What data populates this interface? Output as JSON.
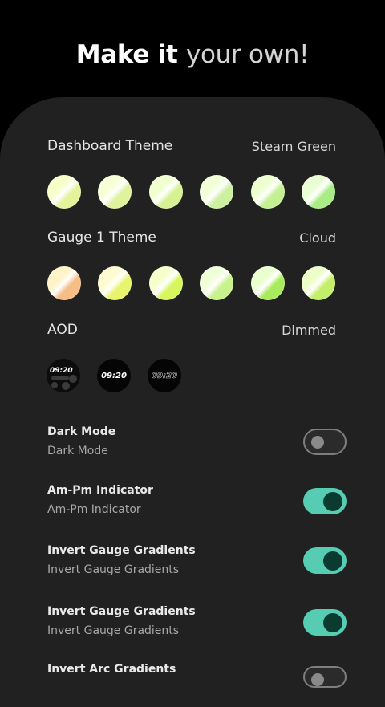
{
  "headline": {
    "main": "Make it",
    "accent": "your own!"
  },
  "dashboard_theme": {
    "title": "Dashboard Theme",
    "value": "Steam Green",
    "swatches": [
      {
        "color_a": "#f7ffc9",
        "color_b": "#e4f39a"
      },
      {
        "color_a": "#f7ffd6",
        "color_b": "#dff29d"
      },
      {
        "color_a": "#f1ffd0",
        "color_b": "#d5f191"
      },
      {
        "color_a": "#f2ffd7",
        "color_b": "#cdf0a0"
      },
      {
        "color_a": "#eeffd0",
        "color_b": "#c4f093"
      },
      {
        "color_a": "#eaffd6",
        "color_b": "#a9ec86"
      }
    ]
  },
  "gauge1_theme": {
    "title": "Gauge 1 Theme",
    "value": "Cloud",
    "swatches": [
      {
        "color_a": "#fff3c8",
        "color_b": "#f6be86"
      },
      {
        "color_a": "#fffbd0",
        "color_b": "#e8f46e"
      },
      {
        "color_a": "#f6ffcc",
        "color_b": "#d7f55c"
      },
      {
        "color_a": "#f0ffd7",
        "color_b": "#c9f28d"
      },
      {
        "color_a": "#eaffd0",
        "color_b": "#aaeb5e"
      },
      {
        "color_a": "#efffc9",
        "color_b": "#c3ee6a"
      }
    ]
  },
  "aod": {
    "title": "AOD",
    "value": "Dimmed",
    "options": [
      {
        "time": "09:20"
      },
      {
        "time": "09:20"
      },
      {
        "time": "09:20"
      }
    ]
  },
  "toggles": [
    {
      "title": "Dark Mode",
      "subtitle": "Dark Mode",
      "state": "off"
    },
    {
      "title": "Am-Pm Indicator",
      "subtitle": "Am-Pm Indicator",
      "state": "on"
    },
    {
      "title": "Invert Gauge Gradients",
      "subtitle": "Invert Gauge Gradients",
      "state": "on"
    },
    {
      "title": "Invert Gauge Gradients",
      "subtitle": "Invert Gauge Gradients",
      "state": "on"
    },
    {
      "title": "Invert Arc Gradients",
      "subtitle": "",
      "state": "off"
    }
  ],
  "colors": {
    "background": "#000000",
    "panel": "#212121",
    "accent_toggle": "#56cdb3",
    "knob_on": "#0b3a30"
  }
}
